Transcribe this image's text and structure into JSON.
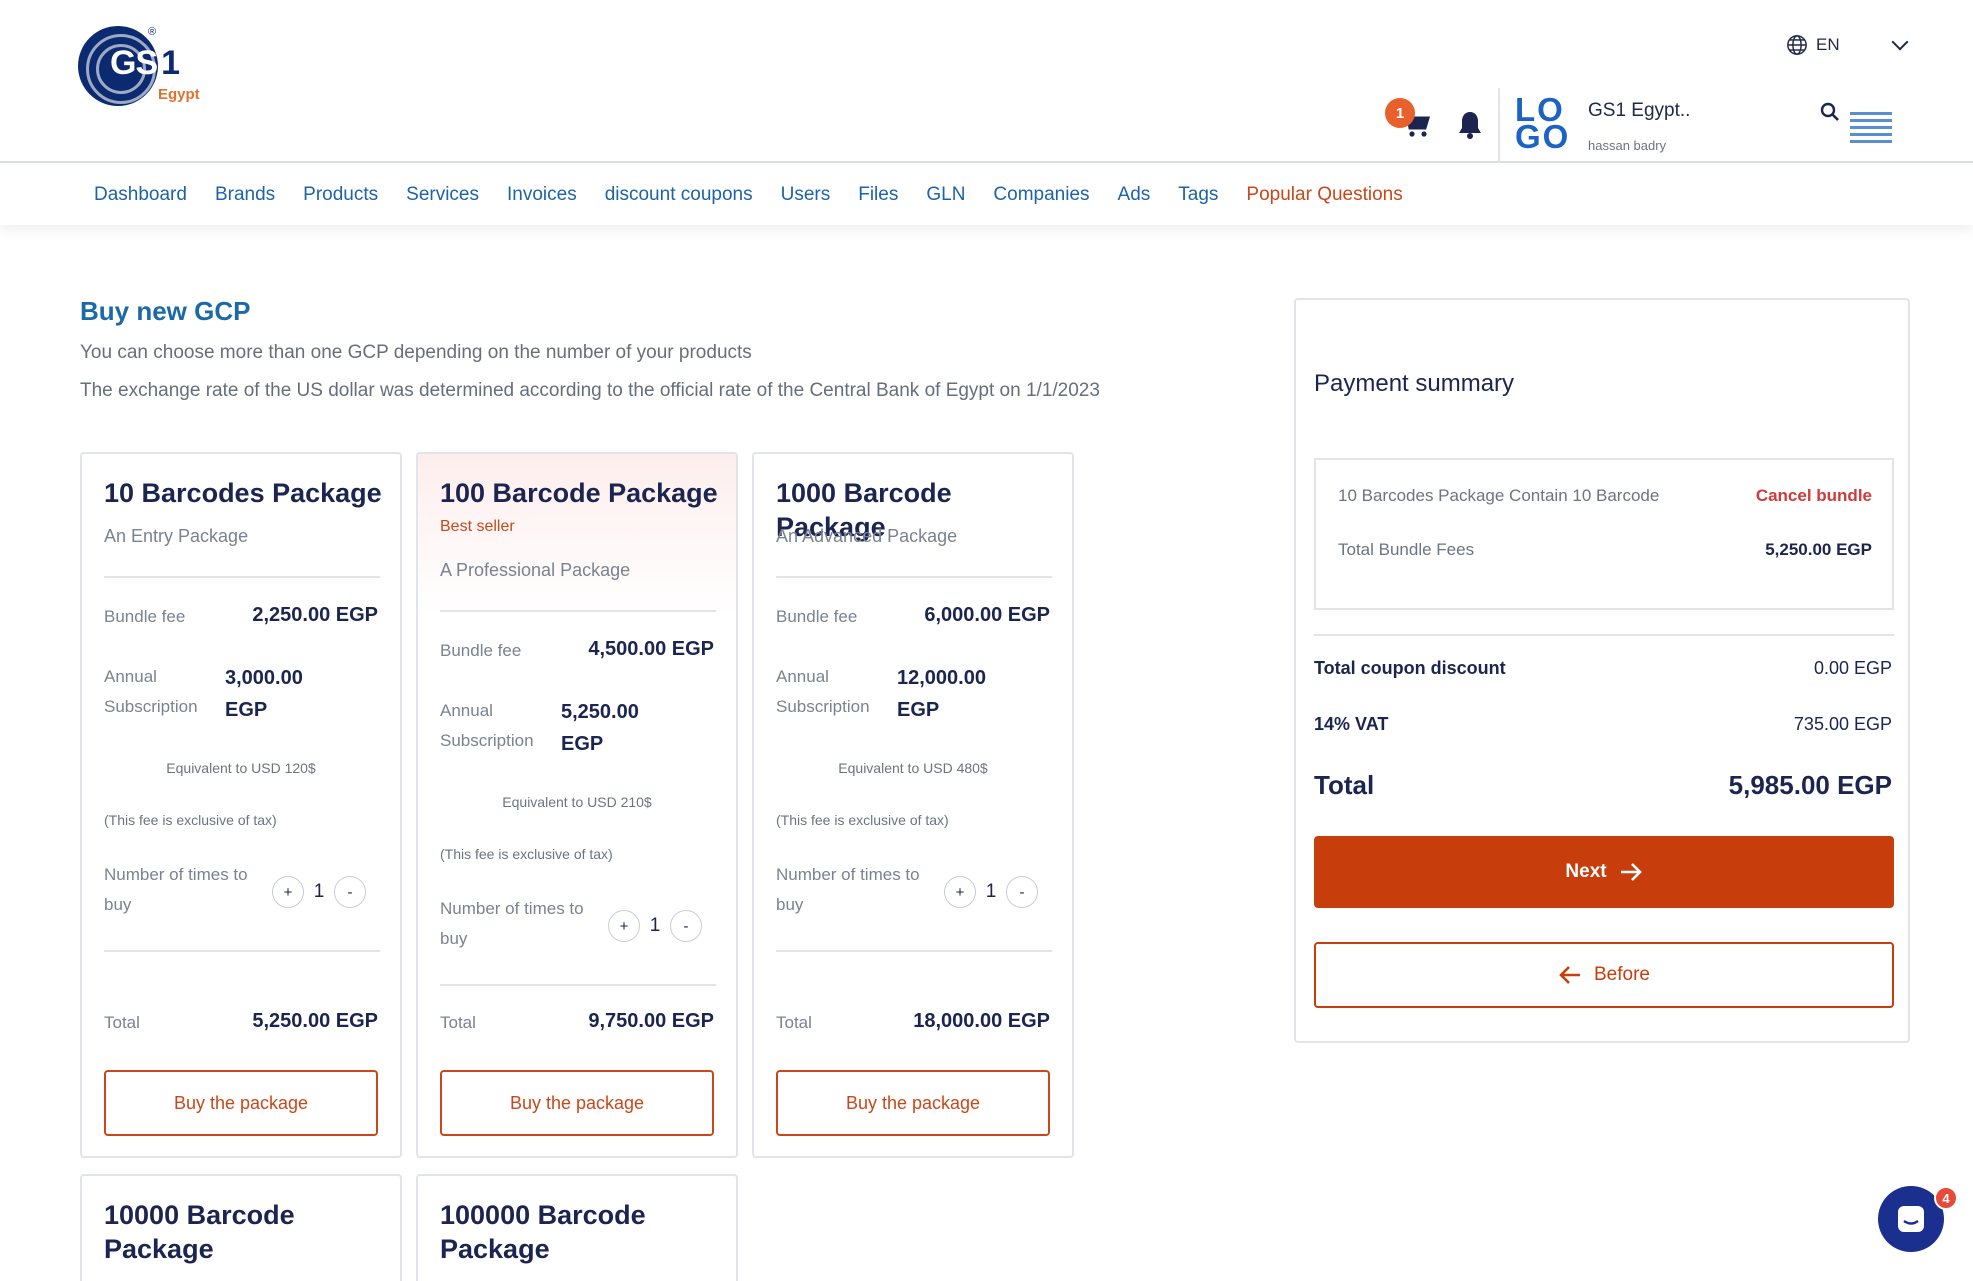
{
  "brand": {
    "logo_text": "GS",
    "logo_one": "1",
    "logo_reg": "®",
    "logo_sub": "Egypt"
  },
  "header": {
    "language": "EN",
    "cart_count": "1",
    "company_logo_line1": "LO",
    "company_logo_line2": "GO",
    "company_name": "GS1 Egypt..",
    "user_name": "hassan badry"
  },
  "nav": {
    "items": [
      "Dashboard",
      "Brands",
      "Products",
      "Services",
      "Invoices",
      "discount coupons",
      "Users",
      "Files",
      "GLN",
      "Companies",
      "Ads",
      "Tags",
      "Popular Questions"
    ]
  },
  "page": {
    "title": "Buy new GCP",
    "intro1": "You can choose more than one GCP depending on the number of your products",
    "intro2": "The exchange rate of the US dollar was determined according to the official rate of the Central Bank of Egypt on 1/1/2023"
  },
  "packages": [
    {
      "title": "10 Barcodes Package",
      "subtitle": "An Entry Package",
      "bundle_fee_label": "Bundle fee",
      "bundle_fee": "2,250.00 EGP",
      "annual_label": "Annual Subscription",
      "annual": "3,000.00 EGP",
      "equivalent": "Equivalent to USD 120$",
      "tax_note": "(This fee is exclusive of tax)",
      "times_label": "Number of times to buy",
      "plus": "+",
      "minus": "-",
      "quantity": "1",
      "total_label": "Total",
      "total": "5,250.00 EGP",
      "buy_label": "Buy the package"
    },
    {
      "title": "100 Barcode Package",
      "badge": "Best seller",
      "subtitle": "A Professional Package",
      "bundle_fee_label": "Bundle fee",
      "bundle_fee": "4,500.00 EGP",
      "annual_label": "Annual Subscription",
      "annual": "5,250.00 EGP",
      "equivalent": "Equivalent to USD 210$",
      "tax_note": "(This fee is exclusive of tax)",
      "times_label": "Number of times to buy",
      "plus": "+",
      "minus": "-",
      "quantity": "1",
      "total_label": "Total",
      "total": "9,750.00 EGP",
      "buy_label": "Buy the package"
    },
    {
      "title": "1000 Barcode Package",
      "subtitle": "An Advanced Package",
      "bundle_fee_label": "Bundle fee",
      "bundle_fee": "6,000.00 EGP",
      "annual_label": "Annual Subscription",
      "annual": "12,000.00 EGP",
      "equivalent": "Equivalent to USD 480$",
      "tax_note": "(This fee is exclusive of tax)",
      "times_label": "Number of times to buy",
      "plus": "+",
      "minus": "-",
      "quantity": "1",
      "total_label": "Total",
      "total": "18,000.00 EGP",
      "buy_label": "Buy the package"
    },
    {
      "title": "10000 Barcode Package"
    },
    {
      "title": "100000 Barcode Package"
    }
  ],
  "summary": {
    "title": "Payment summary",
    "item": "10 Barcodes Package Contain 10 Barcode",
    "cancel_label": "Cancel bundle",
    "fees_label": "Total Bundle Fees",
    "fees_value": "5,250.00 EGP",
    "coupon_label": "Total coupon discount",
    "coupon_value": "0.00 EGP",
    "vat_label": "14% VAT",
    "vat_value": "735.00 EGP",
    "total_label": "Total",
    "total_value": "5,985.00 EGP",
    "next_label": "Next",
    "before_label": "Before"
  },
  "chat": {
    "badge": "4"
  },
  "colors": {
    "accent": "#c83d0c",
    "nav_link": "#1d63a8",
    "title": "#1a6aa8",
    "navy": "#1b2550"
  }
}
